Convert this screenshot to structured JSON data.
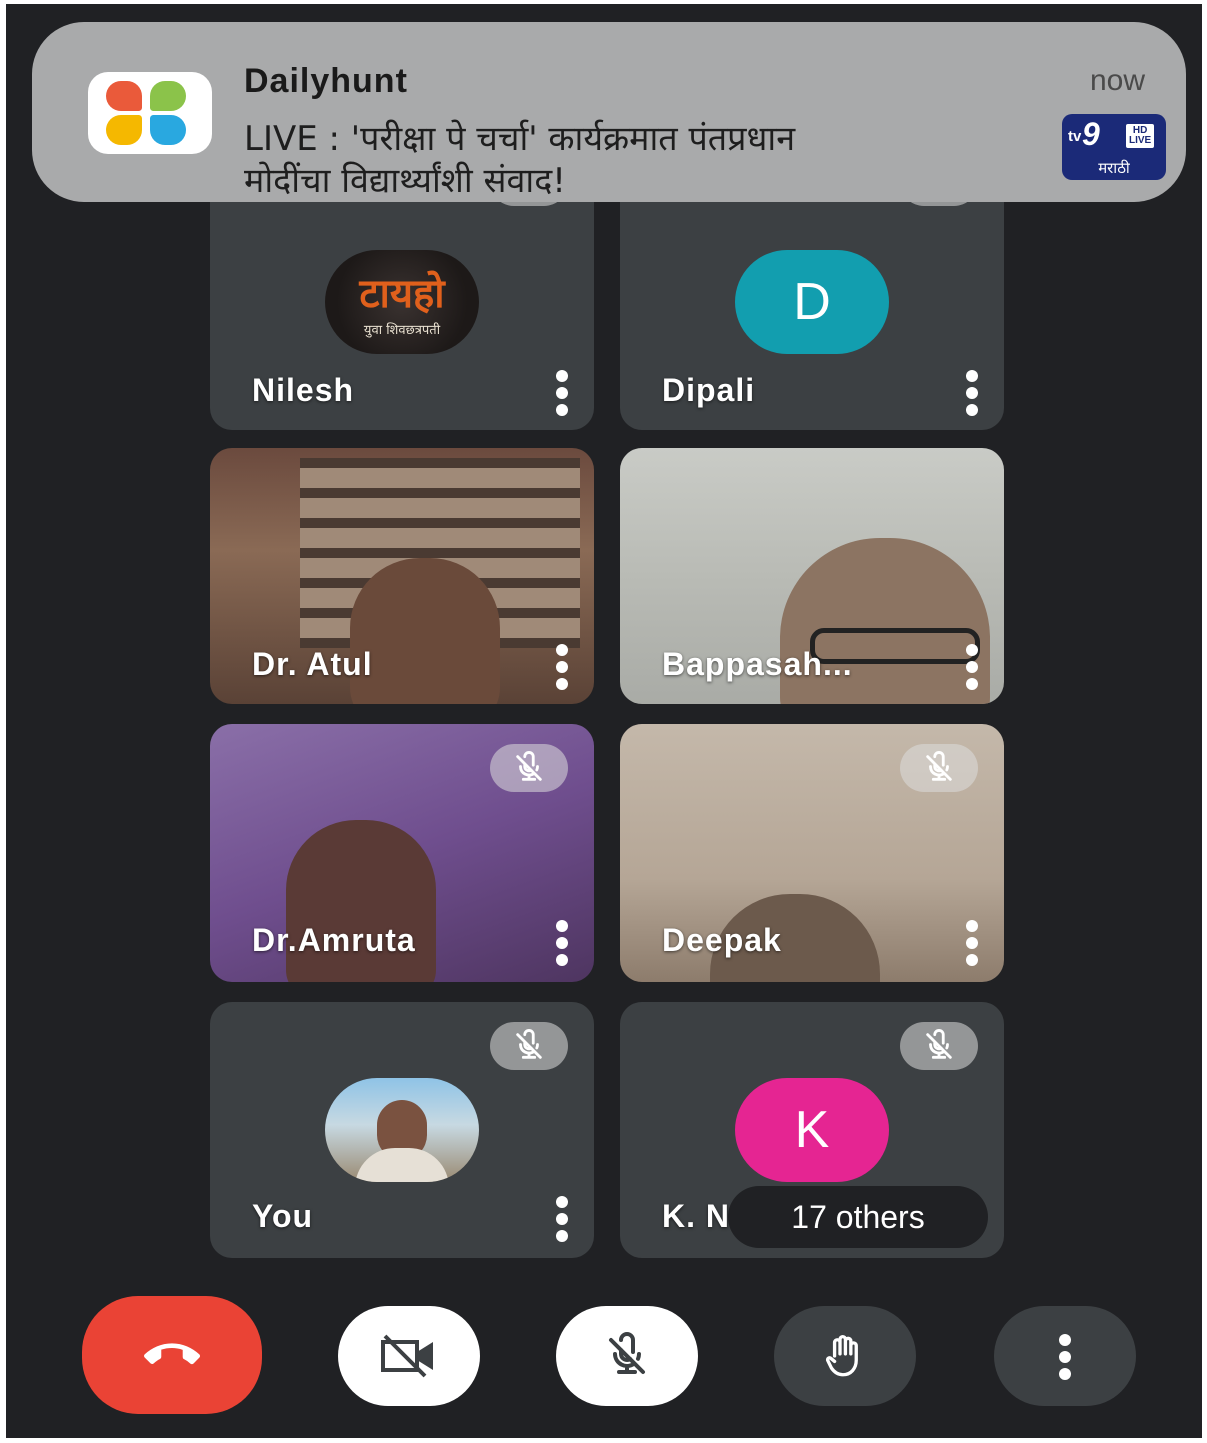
{
  "notification": {
    "app_name": "Dailyhunt",
    "time": "now",
    "line1": "LIVE : 'परीक्षा पे चर्चा' कार्यक्रमात पंतप्रधान",
    "line2": "मोदींचा विद्यार्थ्यांशी संवाद!",
    "thumbnail": {
      "brand": "tv9",
      "badge_top": "HD",
      "badge_bottom": "LIVE",
      "language": "मराठी"
    }
  },
  "participants": [
    {
      "name": "Nilesh",
      "avatar": "logo",
      "logo_text": "टायहो",
      "logo_subtext": "युवा शिवछत्रपती",
      "muted": true
    },
    {
      "name": "Dipali",
      "avatar": "letter",
      "letter": "D",
      "color": "#129eaf",
      "muted": true
    },
    {
      "name": "Dr. Atul",
      "avatar": "video",
      "muted": false
    },
    {
      "name": "Bappasah...",
      "avatar": "video",
      "muted": false
    },
    {
      "name": "Dr.Amruta",
      "avatar": "video",
      "muted": true
    },
    {
      "name": "Deepak",
      "avatar": "video",
      "muted": true
    },
    {
      "name": "You",
      "avatar": "photo",
      "muted": true
    },
    {
      "name": "K. N",
      "avatar": "letter",
      "letter": "K",
      "color": "#e52592",
      "muted": true
    }
  ],
  "others_label": "17 others",
  "controls": {
    "end_call": {
      "icon": "phone-hangup-icon",
      "color": "#ea4335"
    },
    "camera": {
      "icon": "camera-off-icon",
      "state": "off"
    },
    "microphone": {
      "icon": "mic-off-icon",
      "state": "off"
    },
    "raise_hand": {
      "icon": "hand-icon"
    },
    "more": {
      "icon": "more-vert-icon"
    }
  }
}
